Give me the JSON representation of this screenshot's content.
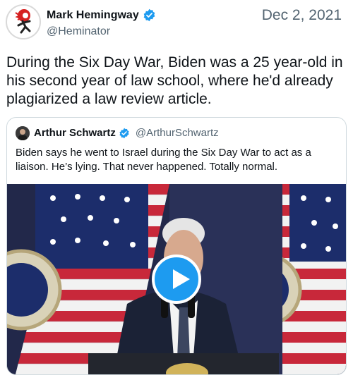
{
  "tweet": {
    "author_name": "Mark Hemingway",
    "handle": "@Heminator",
    "date": "Dec 2, 2021",
    "text": "During the Six Day War, Biden was a 25 year-old in his second year of law school, where he'd already plagiarized a law review article."
  },
  "quoted_tweet": {
    "author_name": "Arthur Schwartz",
    "handle": "@ArthurSchwartz",
    "text": "Biden says he went to Israel during the Six Day War to act as a liaison. He’s lying. That never happened. Totally normal."
  },
  "media": {
    "icon": "play-icon"
  },
  "colors": {
    "verified_blue": "#1d9bf0",
    "play_button": "#1d9bf0",
    "muted_text": "#536471",
    "border": "#cfd9de"
  }
}
